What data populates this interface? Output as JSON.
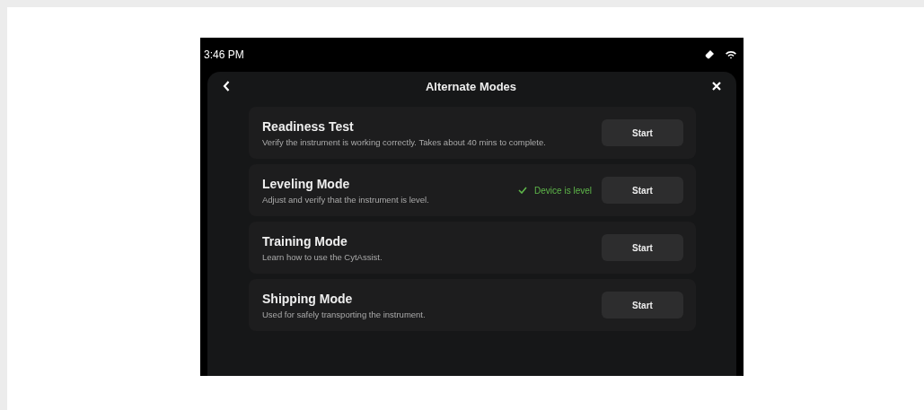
{
  "status_bar": {
    "time": "3:46 PM"
  },
  "header": {
    "title": "Alternate Modes"
  },
  "modes": [
    {
      "title": "Readiness Test",
      "description": "Verify the instrument is working correctly. Takes about 40 mins to complete.",
      "button": "Start"
    },
    {
      "title": "Leveling Mode",
      "description": "Adjust and verify that the instrument is level.",
      "status": "Device is level",
      "button": "Start"
    },
    {
      "title": "Training Mode",
      "description": "Learn how to use the CytAssist.",
      "button": "Start"
    },
    {
      "title": "Shipping Mode",
      "description": "Used for safely transporting the instrument.",
      "button": "Start"
    }
  ]
}
